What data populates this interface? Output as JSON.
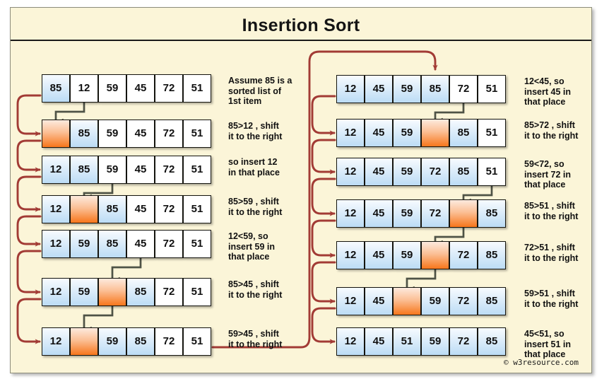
{
  "title": "Insertion  Sort",
  "credit": "© w3resource.com",
  "colors": {
    "page_background": "#fbf5d8",
    "frame_border": "#8d8d7c",
    "cell_border": "#15150f",
    "sorted_blue": "#bcdcf5",
    "active_orange": "#f7761b",
    "flow_arrow_red": "#a23b35",
    "shift_arrow_gray": "#4f5346",
    "text": "#111111"
  },
  "left_column": {
    "steps": [
      {
        "cells": [
          "85",
          "12",
          "59",
          "45",
          "72",
          "51"
        ],
        "states": [
          "blue",
          "white",
          "white",
          "white",
          "white",
          "white"
        ],
        "caption": "Assume 85 is a\nsorted list of\n1st item"
      },
      {
        "cells": [
          "",
          "85",
          "59",
          "45",
          "72",
          "51"
        ],
        "states": [
          "orange",
          "blue",
          "white",
          "white",
          "white",
          "white"
        ],
        "caption": "85>12 , shift\nit to the right"
      },
      {
        "cells": [
          "12",
          "85",
          "59",
          "45",
          "72",
          "51"
        ],
        "states": [
          "blue",
          "blue",
          "white",
          "white",
          "white",
          "white"
        ],
        "caption": "so insert 12\nin that place"
      },
      {
        "cells": [
          "12",
          "",
          "85",
          "45",
          "72",
          "51"
        ],
        "states": [
          "blue",
          "orange",
          "blue",
          "white",
          "white",
          "white"
        ],
        "caption": "85>59 , shift\nit to the right"
      },
      {
        "cells": [
          "12",
          "59",
          "85",
          "45",
          "72",
          "51"
        ],
        "states": [
          "blue",
          "blue",
          "blue",
          "white",
          "white",
          "white"
        ],
        "caption": "12<59, so\ninsert 59 in\nthat place"
      },
      {
        "cells": [
          "12",
          "59",
          "",
          "85",
          "72",
          "51"
        ],
        "states": [
          "blue",
          "blue",
          "orange",
          "blue",
          "white",
          "white"
        ],
        "caption": "85>45 , shift\nit to the right"
      },
      {
        "cells": [
          "12",
          "",
          "59",
          "85",
          "72",
          "51"
        ],
        "states": [
          "blue",
          "orange",
          "blue",
          "blue",
          "white",
          "white"
        ],
        "caption": "59>45 , shift\nit to the right"
      }
    ]
  },
  "right_column": {
    "steps": [
      {
        "cells": [
          "12",
          "45",
          "59",
          "85",
          "72",
          "51"
        ],
        "states": [
          "blue",
          "blue",
          "blue",
          "blue",
          "white",
          "white"
        ],
        "caption": "12<45, so\ninsert 45 in\nthat place"
      },
      {
        "cells": [
          "12",
          "45",
          "59",
          "",
          "85",
          "51"
        ],
        "states": [
          "blue",
          "blue",
          "blue",
          "orange",
          "blue",
          "white"
        ],
        "caption": "85>72 , shift\nit to the right"
      },
      {
        "cells": [
          "12",
          "45",
          "59",
          "72",
          "85",
          "51"
        ],
        "states": [
          "blue",
          "blue",
          "blue",
          "blue",
          "blue",
          "white"
        ],
        "caption": "59<72, so\ninsert 72 in\nthat place"
      },
      {
        "cells": [
          "12",
          "45",
          "59",
          "72",
          "",
          "85"
        ],
        "states": [
          "blue",
          "blue",
          "blue",
          "blue",
          "orange",
          "blue"
        ],
        "caption": "85>51 , shift\nit to the right"
      },
      {
        "cells": [
          "12",
          "45",
          "59",
          "",
          "72",
          "85"
        ],
        "states": [
          "blue",
          "blue",
          "blue",
          "orange",
          "blue",
          "blue"
        ],
        "caption": "72>51 , shift\nit to the right"
      },
      {
        "cells": [
          "12",
          "45",
          "",
          "59",
          "72",
          "85"
        ],
        "states": [
          "blue",
          "blue",
          "orange",
          "blue",
          "blue",
          "blue"
        ],
        "caption": "59>51 , shift\nit to the right"
      },
      {
        "cells": [
          "12",
          "45",
          "51",
          "59",
          "72",
          "85"
        ],
        "states": [
          "blue",
          "blue",
          "blue",
          "blue",
          "blue",
          "blue"
        ],
        "caption": "45<51, so\ninsert 51 in\nthat place"
      }
    ]
  }
}
